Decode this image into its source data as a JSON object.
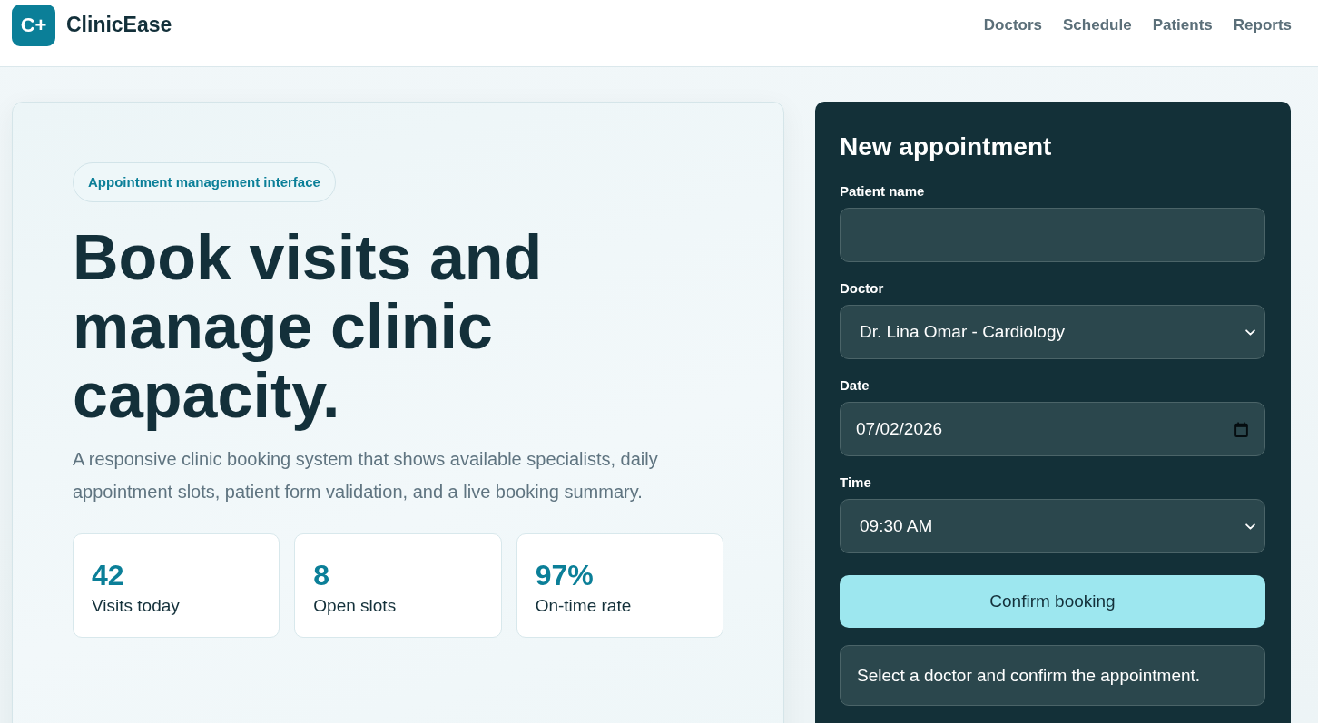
{
  "header": {
    "logo_text": "C+",
    "brand": "ClinicEase",
    "nav": [
      "Doctors",
      "Schedule",
      "Patients",
      "Reports"
    ]
  },
  "hero": {
    "tag": "Appointment management interface",
    "title": "Book visits and manage clinic capacity.",
    "description": "A responsive clinic booking system that shows available specialists, daily appointment slots, patient form validation, and a live booking summary.",
    "stats": [
      {
        "value": "42",
        "label": "Visits today"
      },
      {
        "value": "8",
        "label": "Open slots"
      },
      {
        "value": "97%",
        "label": "On-time rate"
      }
    ]
  },
  "form": {
    "title": "New appointment",
    "fields": [
      {
        "kind": "text",
        "label": "Patient name"
      },
      {
        "kind": "select",
        "label": "Doctor",
        "value": "Dr. Lina Omar - Cardiology"
      },
      {
        "kind": "date",
        "label": "Date",
        "value": "07/02/2026"
      },
      {
        "kind": "select",
        "label": "Time",
        "value": "09:30 AM"
      }
    ],
    "submit": "Confirm booking",
    "message": "Select a doctor and confirm the appointment."
  }
}
